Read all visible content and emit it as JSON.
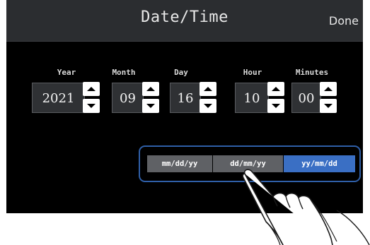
{
  "header": {
    "title": "Date/Time",
    "done_label": "Done"
  },
  "fields": [
    {
      "label": "Year",
      "value": "2021"
    },
    {
      "label": "Month",
      "value": "09"
    },
    {
      "label": "Day",
      "value": "16"
    },
    {
      "label": "Hour",
      "value": "10"
    },
    {
      "label": "Minutes",
      "value": "00"
    }
  ],
  "date_format": {
    "options": [
      "mm/dd/yy",
      "dd/mm/yy",
      "yy/mm/dd"
    ],
    "selected": "yy/mm/dd"
  },
  "colors": {
    "selected_format": "#3a6fc4",
    "unselected_format": "#5f6165",
    "highlight_outline": "#2f5fa8"
  },
  "icons": [
    "arrow-up-icon",
    "arrow-down-icon",
    "pointing-hand-icon"
  ]
}
